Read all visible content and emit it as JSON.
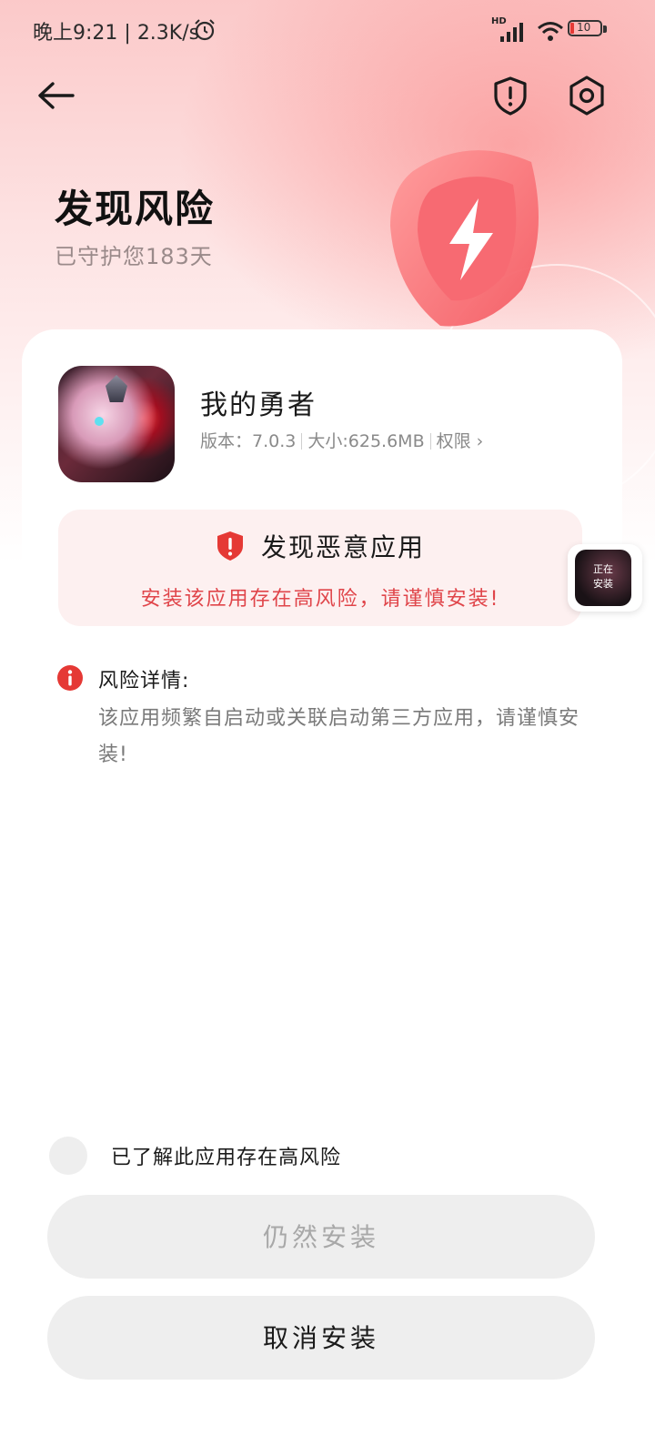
{
  "status_bar": {
    "time": "晚上9:21",
    "net_speed": "2.3K/s",
    "hd_label": "HD",
    "battery_level": "10"
  },
  "header": {
    "title": "发现风险",
    "subtitle": "已守护您183天"
  },
  "app": {
    "name": "我的勇者",
    "version_label": "版本：",
    "version": "7.0.3",
    "size_label": "大小:",
    "size": "625.6MB",
    "permissions_label": "权限",
    "permissions_chevron": "›"
  },
  "warning": {
    "title": "发现恶意应用",
    "message": "安装该应用存在高风险，请谨慎安装!"
  },
  "floating_thumb": {
    "line1": "正在",
    "line2": "安装"
  },
  "risk_detail": {
    "label": "风险详情:",
    "text": "该应用频繁自启动或关联启动第三方应用，请谨慎安装!"
  },
  "acknowledge": {
    "label": "已了解此应用存在高风险",
    "checked": false
  },
  "buttons": {
    "install_anyway": "仍然安装",
    "cancel_install": "取消安装"
  },
  "colors": {
    "accent_red": "#e53935",
    "warning_text": "#e0454a",
    "button_bg": "#eeeeee"
  },
  "icons": [
    "alarm-icon",
    "signal-icon",
    "wifi-icon",
    "battery-icon",
    "back-arrow-icon",
    "shield-alert-icon",
    "gear-icon",
    "lightning-shield-icon",
    "info-icon"
  ]
}
